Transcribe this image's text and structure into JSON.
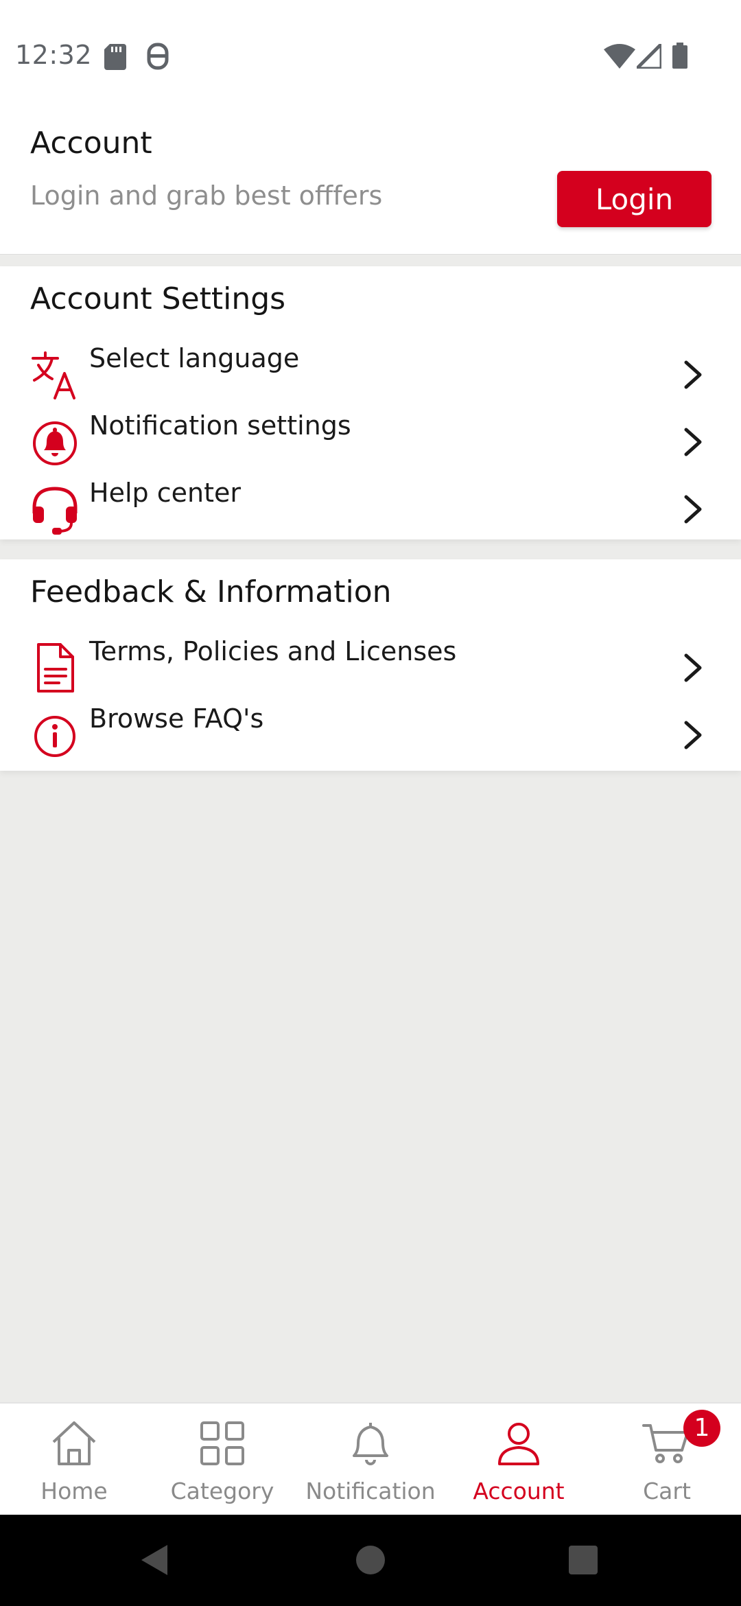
{
  "status_bar": {
    "time": "12:32",
    "left_icons": [
      "sd-card-icon",
      "vpn-key-icon"
    ],
    "right_icons": [
      "wifi-icon",
      "cell-signal-icon",
      "battery-icon"
    ]
  },
  "header": {
    "title": "Account",
    "subtitle": "Login and grab best offfers",
    "login_label": "Login"
  },
  "account_settings": {
    "title": "Account Settings",
    "items": [
      {
        "label": "Select language",
        "icon": "translate-icon"
      },
      {
        "label": "Notification settings",
        "icon": "bell-icon"
      },
      {
        "label": "Help center",
        "icon": "headset-icon"
      }
    ]
  },
  "feedback": {
    "title": "Feedback & Information",
    "items": [
      {
        "label": "Terms, Policies and Licenses",
        "icon": "document-icon"
      },
      {
        "label": "Browse FAQ's",
        "icon": "info-icon"
      }
    ]
  },
  "bottom_nav": {
    "items": [
      {
        "label": "Home",
        "icon": "home-icon",
        "active": false
      },
      {
        "label": "Category",
        "icon": "grid-icon",
        "active": false
      },
      {
        "label": "Notification",
        "icon": "bell-outline-icon",
        "active": false
      },
      {
        "label": "Account",
        "icon": "person-icon",
        "active": true
      },
      {
        "label": "Cart",
        "icon": "cart-icon",
        "active": false
      }
    ],
    "cart_badge": "1"
  },
  "colors": {
    "accent": "#d4001e",
    "background": "#ececea",
    "card": "#ffffff",
    "muted_text": "#8e8e8e"
  }
}
